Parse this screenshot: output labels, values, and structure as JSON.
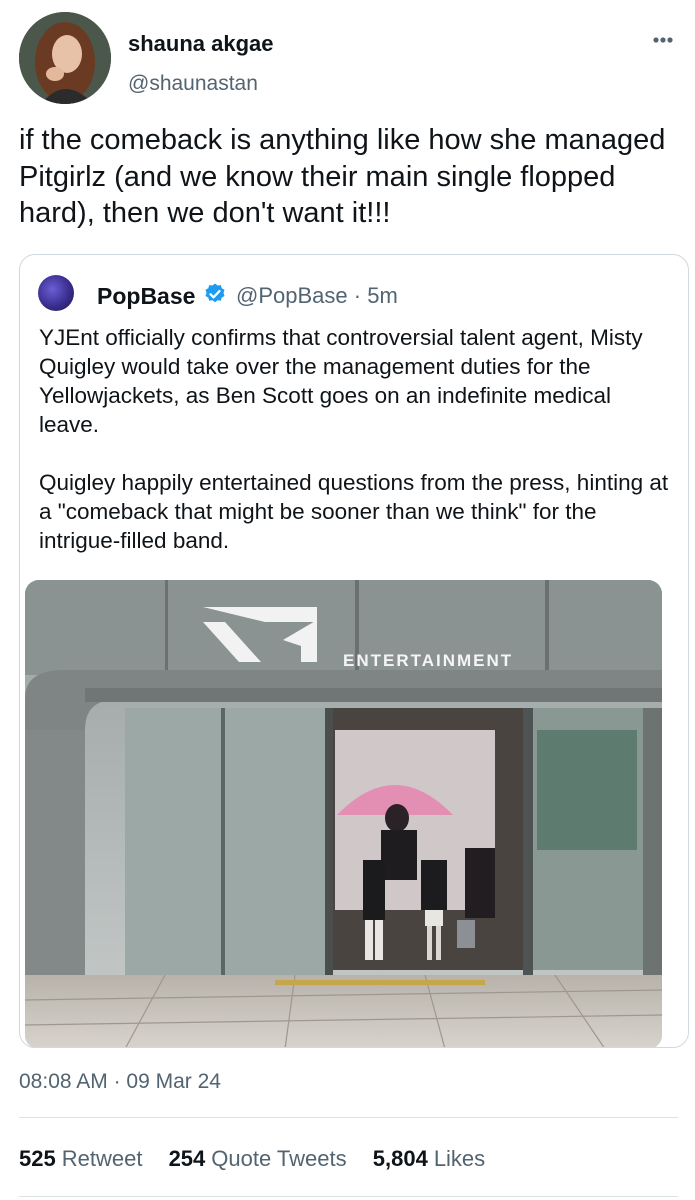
{
  "author": {
    "display_name": "shauna akgae",
    "handle": "@shaunastan"
  },
  "tweet": {
    "text": "if the comeback is anything like how she managed Pitgirlz (and we know their main single flopped hard), then we don't want it!!!"
  },
  "quoted_tweet": {
    "name": "PopBase",
    "handle": "@PopBase",
    "time": "5m",
    "paragraph_1": "YJEnt officially confirms that controversial talent agent, Misty Quigley would take over the management duties for the Yellowjackets, as Ben Scott goes on an indefinite medical leave.",
    "paragraph_2": "Quigley happily entertained questions from the press, hinting at a \"comeback that might be sooner than we think\" for the intrigue-filled band.",
    "image_sign_text": "ENTERTAINMENT"
  },
  "timestamp": {
    "time": "08:08 AM",
    "separator": "·",
    "date": "09 Mar 24"
  },
  "stats": {
    "retweets_count": "525",
    "retweets_label": "Retweet",
    "quotes_count": "254",
    "quotes_label": "Quote Tweets",
    "likes_count": "5,804",
    "likes_label": "Likes"
  },
  "colors": {
    "secondary_text": "#536471",
    "verified_blue": "#1d9bf0",
    "border": "#cfd9de"
  },
  "icons": [
    "more-options-icon",
    "verified-badge-icon"
  ]
}
